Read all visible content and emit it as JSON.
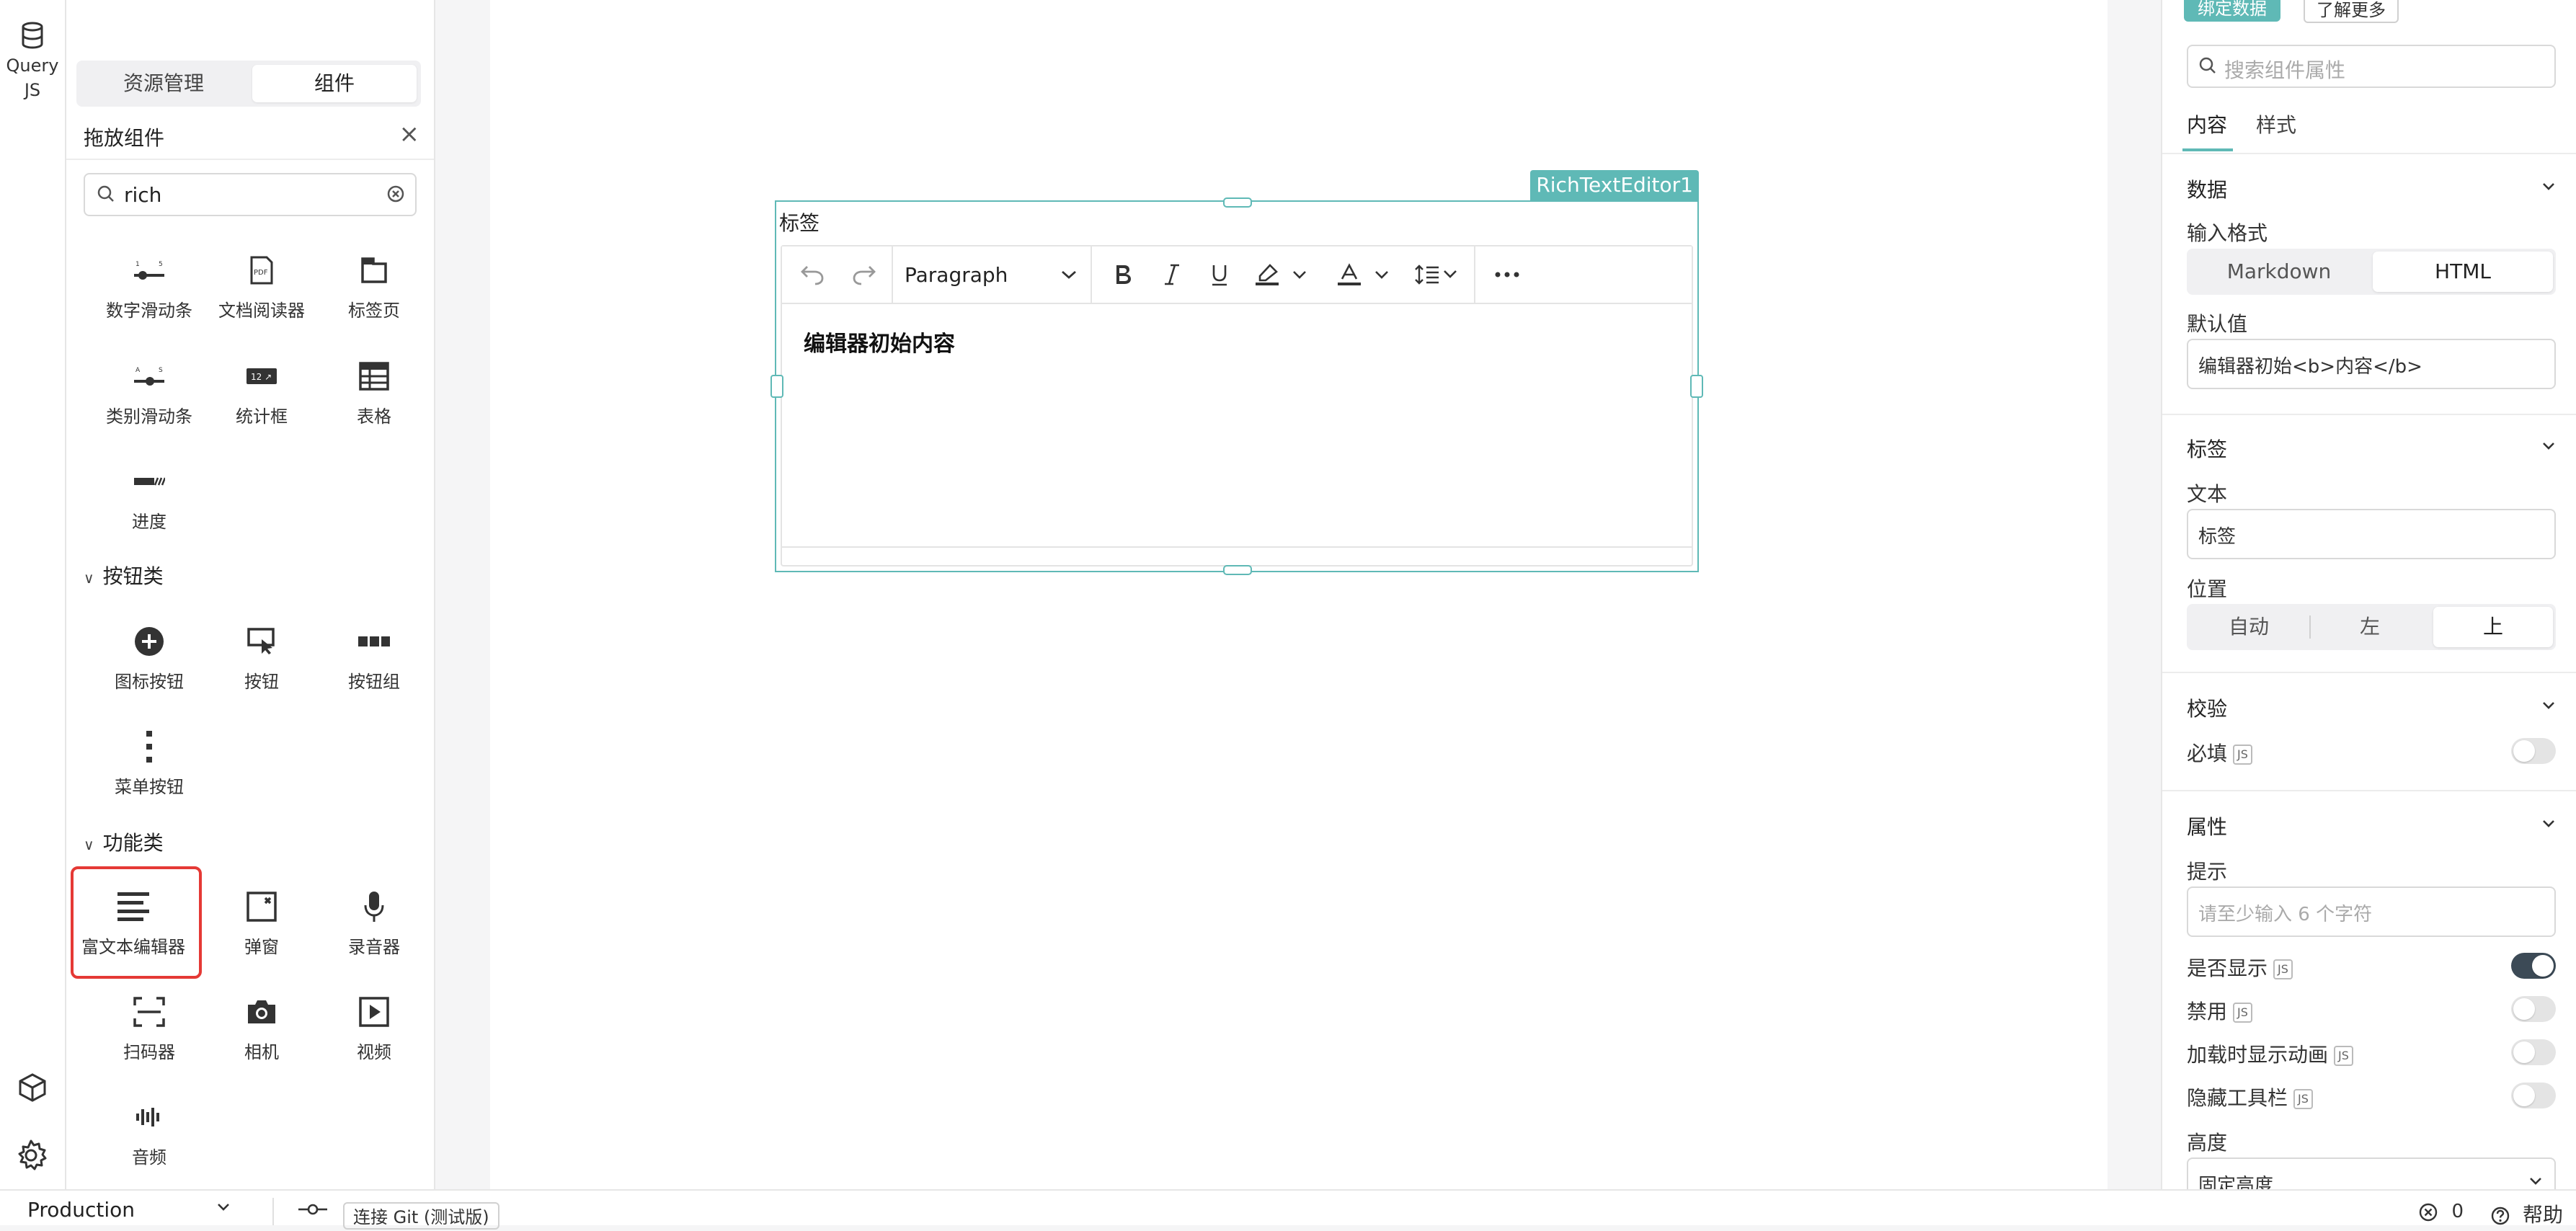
{
  "left_bar": {
    "query_label_1": "Query",
    "query_label_2": "JS"
  },
  "components_panel": {
    "tabs": [
      {
        "label": "资源管理"
      },
      {
        "label": "组件"
      }
    ],
    "header_title": "拖放组件",
    "search": {
      "value": "rich"
    },
    "items_top": [
      {
        "label": "数字滑动条",
        "icon": "number-slider-icon"
      },
      {
        "label": "文档阅读器",
        "icon": "pdf-reader-icon"
      },
      {
        "label": "标签页",
        "icon": "tabs-icon"
      },
      {
        "label": "类别滑动条",
        "icon": "category-slider-icon"
      },
      {
        "label": "统计框",
        "icon": "statistic-icon"
      },
      {
        "label": "表格",
        "icon": "table-icon"
      },
      {
        "label": "进度",
        "icon": "progress-icon"
      }
    ],
    "section_buttons": {
      "title": "按钮类",
      "items": [
        {
          "label": "图标按钮",
          "icon": "plus-circle-icon"
        },
        {
          "label": "按钮",
          "icon": "button-cursor-icon"
        },
        {
          "label": "按钮组",
          "icon": "button-group-icon"
        },
        {
          "label": "菜单按钮",
          "icon": "kebab-menu-icon"
        }
      ]
    },
    "section_functions": {
      "title": "功能类",
      "items": [
        {
          "label": "富文本编辑器",
          "icon": "rich-text-icon"
        },
        {
          "label": "弹窗",
          "icon": "modal-icon"
        },
        {
          "label": "录音器",
          "icon": "microphone-icon"
        },
        {
          "label": "扫码器",
          "icon": "scanner-icon"
        },
        {
          "label": "相机",
          "icon": "camera-icon"
        },
        {
          "label": "视频",
          "icon": "video-icon"
        },
        {
          "label": "音频",
          "icon": "audio-icon"
        }
      ]
    }
  },
  "canvas": {
    "component_name": "RichTextEditor1",
    "label": "标签",
    "toolbar": {
      "block_format": "Paragraph"
    },
    "content_prefix": "编辑器初始",
    "content_bold": "内容"
  },
  "props_panel": {
    "top_buttons": {
      "bind_data": "绑定数据",
      "learn_more": "了解更多"
    },
    "search_placeholder": "搜索组件属性",
    "tabs": [
      {
        "label": "内容"
      },
      {
        "label": "样式"
      }
    ],
    "data_section": {
      "title": "数据",
      "input_format_label": "输入格式",
      "formats": [
        "Markdown",
        "HTML"
      ],
      "selected_format": "HTML",
      "default_value_label": "默认值",
      "default_value": "编辑器初始<b>内容</b>"
    },
    "label_section": {
      "title": "标签",
      "text_label": "文本",
      "text_value": "标签",
      "position_label": "位置",
      "positions": [
        "自动",
        "左",
        "上"
      ],
      "selected_position": "上"
    },
    "validation_section": {
      "title": "校验",
      "required_label": "必填",
      "required": false
    },
    "attr_section": {
      "title": "属性",
      "hint_label": "提示",
      "hint_placeholder": "请至少输入 6 个字符",
      "visible_label": "是否显示",
      "visible": true,
      "disabled_label": "禁用",
      "disabled": false,
      "loading_label": "加载时显示动画",
      "loading": false,
      "hide_toolbar_label": "隐藏工具栏",
      "hide_toolbar": false,
      "height_label": "高度",
      "height_value": "固定高度"
    },
    "js_badge": "JS"
  },
  "bottom_bar": {
    "environment": "Production",
    "git_button": "连接 Git (测试版)",
    "error_count": "0",
    "help": "帮助"
  },
  "colors": {
    "accent": "#5fb9b6",
    "highlight": "#e53935",
    "toggle_on": "#3c4a56"
  }
}
